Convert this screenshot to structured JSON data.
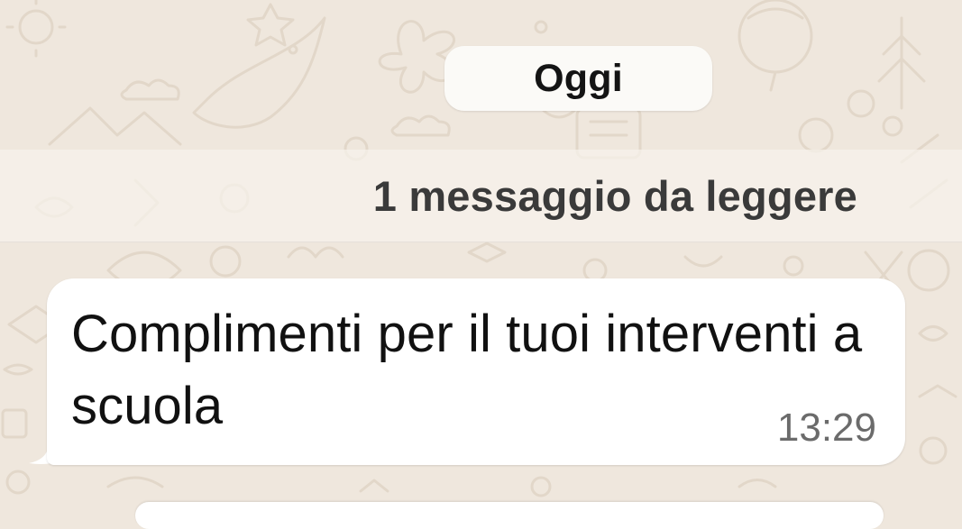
{
  "theme": {
    "wallpaper_color": "#efe7dd",
    "doodle_color": "#e3d9cc",
    "bubble_color": "#ffffff",
    "pill_color": "#fbfaf7"
  },
  "date_separator": {
    "label": "Oggi"
  },
  "unread_banner": {
    "label": "1 messaggio da leggere"
  },
  "messages": [
    {
      "direction": "incoming",
      "text": "Complimenti per il tuoi interventi a scuola",
      "time": "13:29"
    }
  ],
  "icons": {
    "wallpaper": "doodle-pattern"
  }
}
